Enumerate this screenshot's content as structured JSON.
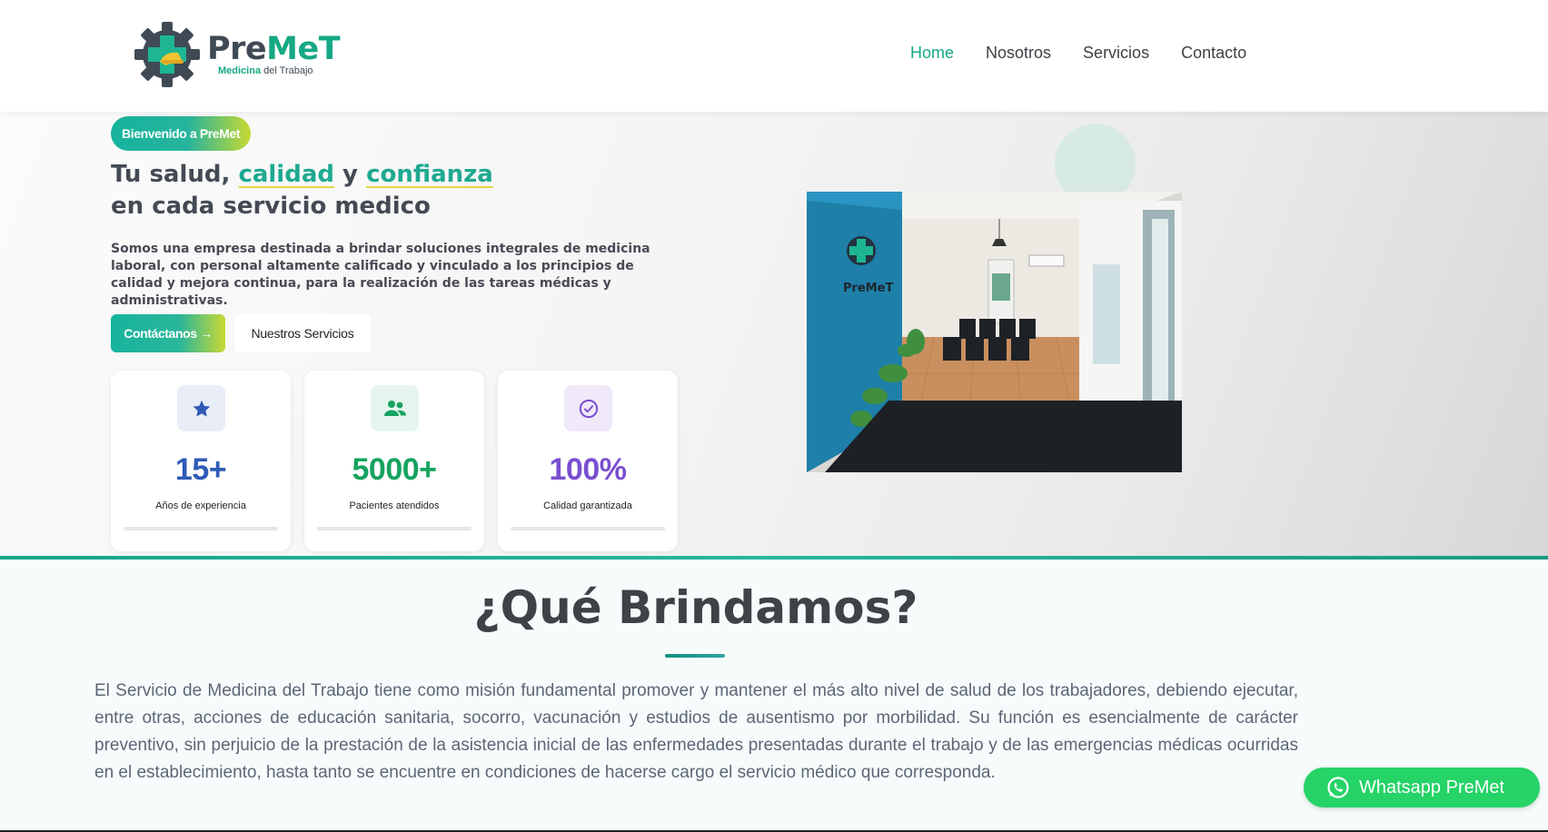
{
  "header": {
    "logo": {
      "name_part1": "Pre",
      "name_part2": "MeT",
      "tagline_part1": "Medicina ",
      "tagline_part2": "del Trabajo"
    },
    "nav": [
      {
        "label": "Home",
        "active": true
      },
      {
        "label": "Nosotros",
        "active": false
      },
      {
        "label": "Servicios",
        "active": false
      },
      {
        "label": "Contacto",
        "active": false
      }
    ]
  },
  "hero": {
    "badge": "Bienvenido a PreMet",
    "title": {
      "prefix": "Tu salud, ",
      "highlight1": "calidad",
      "connector": " y ",
      "highlight2": "confianza",
      "line2": "en cada servicio medico"
    },
    "description": "Somos una empresa destinada a brindar soluciones integrales de medicina laboral, con personal altamente calificado y vinculado a los principios de calidad y mejora continua, para la realización de las tareas médicas y administrativas.",
    "primary_button": "Contáctanos →",
    "secondary_button": "Nuestros Servicios",
    "stats": [
      {
        "icon": "star-icon",
        "value": "15+",
        "label": "Años de experiencia",
        "color": "#2f5bb7",
        "icon_bg": "#e8edf7"
      },
      {
        "icon": "users-icon",
        "value": "5000+",
        "label": "Pacientes atendidos",
        "color": "#16a35f",
        "icon_bg": "#e6f5ee"
      },
      {
        "icon": "check-circle-icon",
        "value": "100%",
        "label": "Calidad garantizada",
        "color": "#7a4fd0",
        "icon_bg": "#efe9f9"
      }
    ],
    "photo_sign": "PreMeT"
  },
  "section": {
    "title": "¿Qué Brindamos?",
    "text": "El Servicio de Medicina del Trabajo tiene como misión fundamental promover y mantener el más alto nivel de salud de los trabajadores, debiendo ejecutar, entre otras, acciones de educación sanitaria, socorro, vacunación y estudios de ausentismo por morbilidad. Su función es esencialmente de carácter preventivo, sin perjuicio de la prestación de la asistencia inicial de las enfermedades presentadas durante el trabajo y de las emergencias médicas ocurridas en el establecimiento, hasta tanto se encuentre en condiciones de hacerse cargo el servicio médico que corresponda."
  },
  "whatsapp": {
    "label": "Whatsapp PreMet",
    "icon": "whatsapp-icon"
  },
  "colors": {
    "brand": "#16a884",
    "brand_dark": "#3f4a55",
    "whatsapp": "#25d366"
  }
}
